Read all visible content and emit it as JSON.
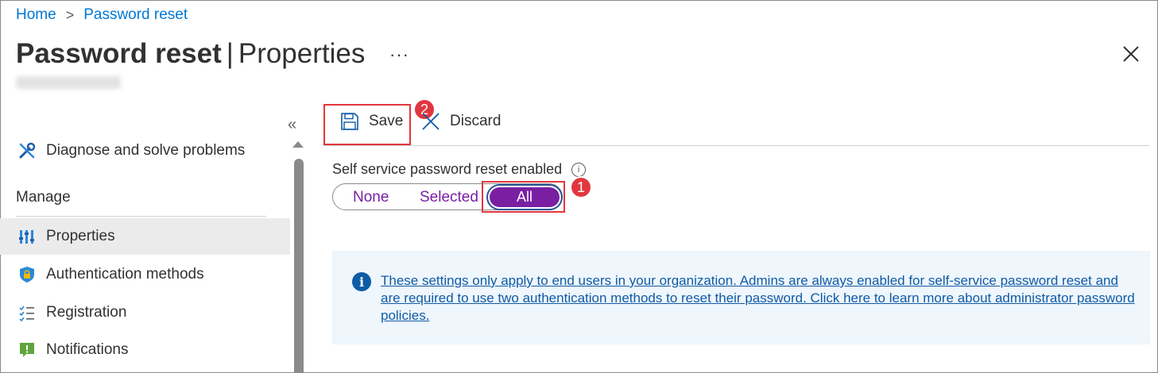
{
  "breadcrumb": {
    "home": "Home",
    "separator": ">",
    "current": "Password reset"
  },
  "header": {
    "title_bold": "Password reset",
    "pipe": "|",
    "title_rest": "Properties",
    "more": "···",
    "close_icon": "close-icon"
  },
  "sidebar": {
    "collapse": "«",
    "items": [
      {
        "label": "Diagnose and solve problems",
        "icon": "wrench-icon",
        "selected": false
      },
      {
        "label": "Properties",
        "icon": "properties-icon",
        "selected": true
      },
      {
        "label": "Authentication methods",
        "icon": "shield-icon",
        "selected": false
      },
      {
        "label": "Registration",
        "icon": "checklist-icon",
        "selected": false
      },
      {
        "label": "Notifications",
        "icon": "notification-icon",
        "selected": false
      }
    ],
    "section": "Manage"
  },
  "toolbar": {
    "save_label": "Save",
    "discard_label": "Discard"
  },
  "annotations": {
    "save_badge": "2",
    "all_badge": "1",
    "color": "#e2363f"
  },
  "sspr": {
    "label": "Self service password reset enabled",
    "info": "i",
    "options": [
      "None",
      "Selected",
      "All"
    ],
    "selected": "All",
    "accent": "#7a1fa2"
  },
  "banner": {
    "icon": "info-icon",
    "text": "These settings only apply to end users in your organization. Admins are always enabled for self-service password reset and are required to use two authentication methods to reset their password. Click here to learn more about administrator password policies."
  }
}
